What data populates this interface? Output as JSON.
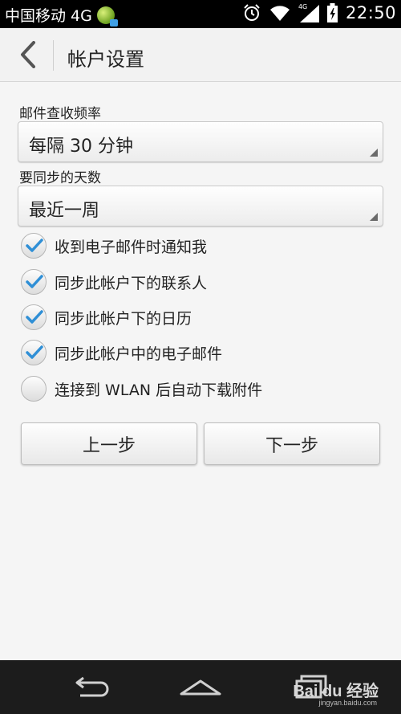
{
  "status_bar": {
    "carrier": "中国移动 4G",
    "network_mini": "4G",
    "time": "22:50"
  },
  "header": {
    "title": "帐户设置"
  },
  "form": {
    "check_frequency": {
      "label": "邮件查收频率",
      "value": "每隔 30 分钟"
    },
    "sync_days": {
      "label": "要同步的天数",
      "value": "最近一周"
    },
    "options": [
      {
        "label": "收到电子邮件时通知我",
        "checked": true
      },
      {
        "label": "同步此帐户下的联系人",
        "checked": true
      },
      {
        "label": "同步此帐户下的日历",
        "checked": true
      },
      {
        "label": "同步此帐户中的电子邮件",
        "checked": true
      },
      {
        "label": "连接到 WLAN 后自动下载附件",
        "checked": false
      }
    ]
  },
  "buttons": {
    "prev": "上一步",
    "next": "下一步"
  },
  "watermark": {
    "text": "Bai du 经验",
    "sub": "jingyan.baidu.com"
  },
  "colors": {
    "check_blue": "#2f8fd6",
    "status_bar": "#000000",
    "nav_bar": "#1c1c1c"
  },
  "icons": {
    "back": "chevron-left-icon",
    "alarm": "alarm-icon",
    "wifi": "wifi-icon",
    "signal": "signal-icon",
    "battery": "battery-icon",
    "nav_back": "nav-back-icon",
    "nav_home": "nav-home-icon",
    "nav_recent": "nav-recent-icon"
  }
}
